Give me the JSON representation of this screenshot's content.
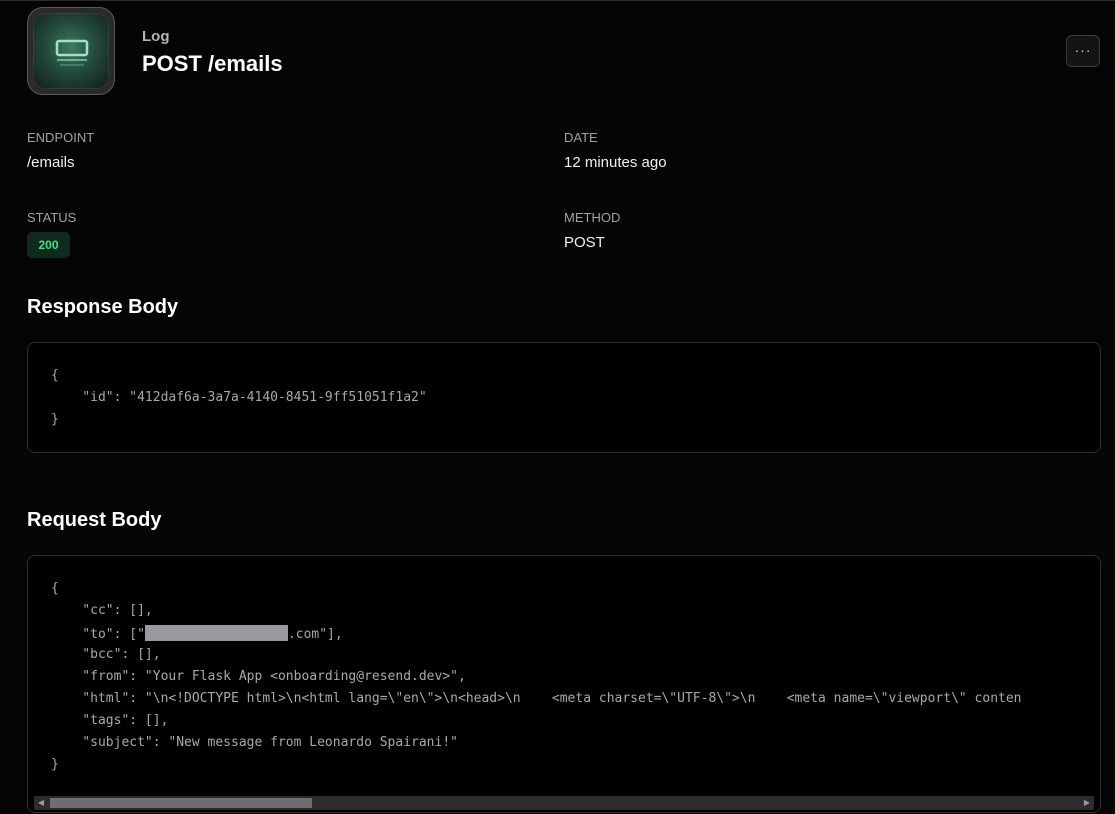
{
  "header": {
    "kicker": "Log",
    "title": "POST /emails",
    "more_button_label": "···",
    "icon": "log-icon"
  },
  "details": {
    "endpoint": {
      "label": "ENDPOINT",
      "value": "/emails"
    },
    "date": {
      "label": "DATE",
      "value": "12 minutes ago"
    },
    "status": {
      "label": "STATUS",
      "value": "200"
    },
    "method": {
      "label": "METHOD",
      "value": "POST"
    }
  },
  "response_body": {
    "heading": "Response Body",
    "lines": [
      "{",
      "    \"id\": \"412daf6a-3a7a-4140-8451-9ff51051f1a2\"",
      "}"
    ]
  },
  "request_body": {
    "heading": "Request Body",
    "lines": [
      "{",
      "    \"cc\": [],",
      "    \"to\": [\"",
      "    \"bcc\": [],",
      "    \"from\": \"Your Flask App <onboarding@resend.dev>\",",
      "    \"html\": \"\\n<!DOCTYPE html>\\n<html lang=\\\"en\\\">\\n<head>\\n    <meta charset=\\\"UTF-8\\\">\\n    <meta name=\\\"viewport\\\" conten",
      "    \"tags\": [],",
      "    \"subject\": \"New message from Leonardo Spairani!\"",
      "}"
    ],
    "to_suffix": ".com\"],"
  },
  "colors": {
    "background": "#050505",
    "status_ok": "#4ade80",
    "status_ok_bg": "#0f2a1e"
  }
}
